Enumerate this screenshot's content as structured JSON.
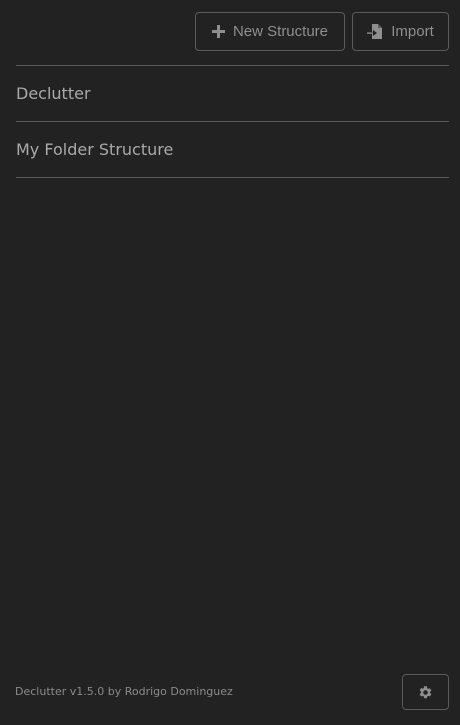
{
  "toolbar": {
    "new_label": "New Structure",
    "new_icon": "plus-icon",
    "import_label": "Import",
    "import_icon": "file-import-icon"
  },
  "structures": [
    {
      "name": "Declutter"
    },
    {
      "name": "My Folder Structure"
    }
  ],
  "footer": {
    "version_text": "Declutter v1.5.0 by Rodrigo Dominguez",
    "settings_icon": "gear-icon"
  },
  "colors": {
    "background": "#222222",
    "border": "#5a5a5a",
    "text": "#a9a9a9"
  }
}
